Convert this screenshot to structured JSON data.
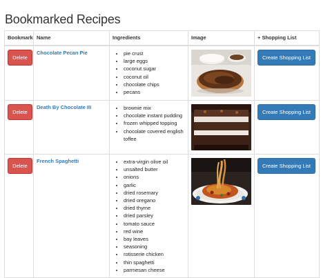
{
  "page": {
    "title": "Bookmarked Recipes"
  },
  "table": {
    "headers": {
      "bookmark": "Bookmark",
      "name": "Name",
      "ingredients": "Ingredients",
      "image": "Image",
      "shopping": "+ Shopping List"
    }
  },
  "rows": [
    {
      "delete_label": "Delete",
      "name": "Chocolate Pecan Pie",
      "ingredients": [
        "pie crust",
        "large eggs",
        "coconut sugar",
        "coconut oil",
        "chocolate chips",
        "pecans"
      ],
      "shopping_label": "Create Shopping List"
    },
    {
      "delete_label": "Delete",
      "name": "Death By Chocolate III",
      "ingredients": [
        "brownie mix",
        "chocolate instant pudding",
        "frozen whipped topping",
        "chocolate covered english toffee"
      ],
      "shopping_label": "Create Shopping List"
    },
    {
      "delete_label": "Delete",
      "name": "French Spaghetti",
      "ingredients": [
        "extra-virgin olive oil",
        "unsalted butter",
        "onions",
        "garlic",
        "dried rosemary",
        "dried oregano",
        "dried thyme",
        "dried parsley",
        "tomato sauce",
        "red wine",
        "bay leaves",
        "seasoning",
        "rotisserie chicken",
        "thin spaghetti",
        "parmesan cheese"
      ],
      "shopping_label": "Create Shopping List"
    }
  ]
}
